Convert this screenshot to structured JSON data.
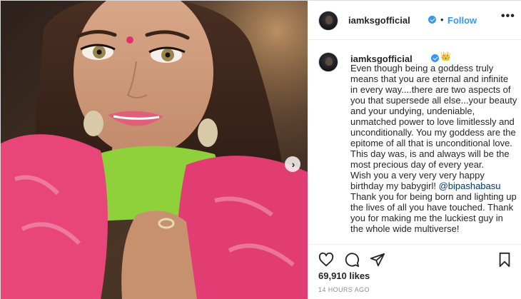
{
  "post": {
    "username": "iamksgofficial",
    "follow_label": "Follow",
    "dot_separator": "•",
    "more_label": "•••",
    "caption_emoji": "👑",
    "caption_lines": [
      "Even though being a goddess truly means that you are eternal and infinite in every way....there are two aspects of you that supersede all else...your beauty and your undying, undeniable, unmatched power to love limitlessly and unconditionally. You my goddess are the epitome of all that is unconditional love. This day was, is and always will be the most precious day of every year.",
      "Wish you a very very very happy birthday my babygirl! "
    ],
    "caption_mention": "@bipashabasu",
    "caption_after": "Thank you for being born and lighting up the lives of all you have touched. Thank you for making me the luckiest guy in the whole wide multiverse!",
    "likes": "69,910 likes",
    "timestamp": "14 HOURS AGO"
  },
  "icons": {
    "like": "heart-icon",
    "comment": "comment-icon",
    "share": "share-icon",
    "save": "bookmark-icon",
    "carousel_next": "chevron-right-icon",
    "verified": "verified-badge-icon"
  },
  "colors": {
    "accent": "#3897f0",
    "mention": "#00376b",
    "muted": "#8e8e8e",
    "text": "#262626",
    "saree_pink": "#e8467a",
    "blouse_green": "#8ed13a"
  }
}
